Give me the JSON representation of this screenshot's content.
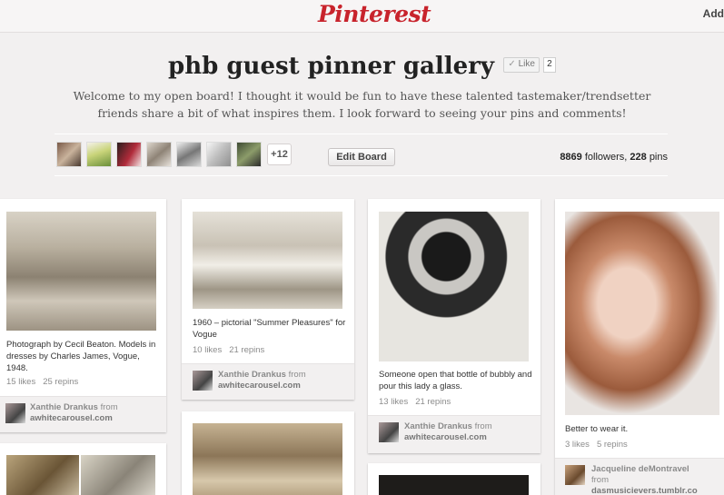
{
  "header": {
    "logo": "Pinterest",
    "add_label": "Add"
  },
  "board": {
    "title": "phb guest pinner gallery",
    "like_label": "Like",
    "like_count": "2",
    "description": "Welcome to my open board! I thought it would be fun to have these talented tastemaker/trendsetter friends share a bit of what inspires them. I look forward to seeing your pins and comments!",
    "more_pinners": "+12",
    "edit_label": "Edit Board",
    "followers_count": "8869",
    "followers_label": "followers,",
    "pins_count": "228",
    "pins_label": "pins"
  },
  "pins": [
    {
      "description": "Photograph by Cecil Beaton. Models in dresses by Charles James, Vogue, 1948.",
      "likes": "15 likes",
      "repins": "25 repins",
      "user": "Xanthie Drankus",
      "from": "from",
      "source": "awhitecarousel.com"
    },
    {
      "description": "1960 – pictorial \"Summer Pleasures\" for Vogue",
      "likes": "10 likes",
      "repins": "21 repins",
      "user": "Xanthie Drankus",
      "from": "from",
      "source": "awhitecarousel.com"
    },
    {
      "description": "Someone open that bottle of bubbly and pour this lady a glass.",
      "likes": "13 likes",
      "repins": "21 repins",
      "user": "Xanthie Drankus",
      "from": "from",
      "source": "awhitecarousel.com"
    },
    {
      "description": "Better to wear it.",
      "likes": "3 likes",
      "repins": "5 repins",
      "user": "Jacqueline deMontravel",
      "from": "from",
      "source": "dasmusicievers.tumblr.co"
    }
  ],
  "colors": {
    "brand_red": "#c8232c",
    "background": "#f2f0f0"
  }
}
